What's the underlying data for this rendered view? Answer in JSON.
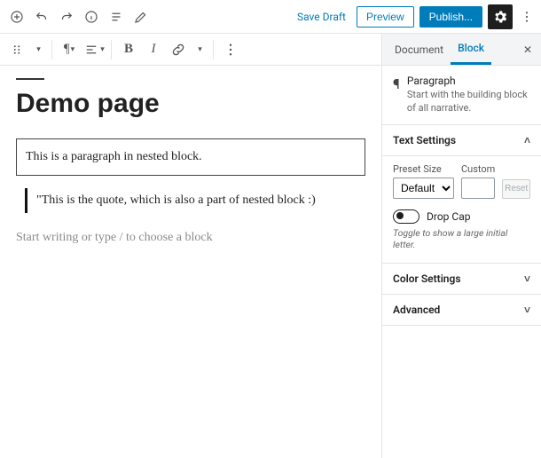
{
  "header": {
    "save_draft": "Save Draft",
    "preview": "Preview",
    "publish": "Publish..."
  },
  "page": {
    "title": "Demo page",
    "paragraph": "This is a paragraph in nested block.",
    "quote": "\"This is the quote, which is also a part of nested block :)",
    "placeholder": "Start writing or type / to choose a block"
  },
  "sidebar": {
    "tabs": {
      "document": "Document",
      "block": "Block"
    },
    "block": {
      "name": "Paragraph",
      "desc": "Start with the building block of all narrative."
    },
    "panels": {
      "text": "Text Settings",
      "preset_label": "Preset Size",
      "preset_value": "Default",
      "custom_label": "Custom",
      "custom_value": "",
      "reset": "Reset",
      "dropcap_label": "Drop Cap",
      "dropcap_hint": "Toggle to show a large initial letter.",
      "color": "Color Settings",
      "advanced": "Advanced"
    }
  }
}
